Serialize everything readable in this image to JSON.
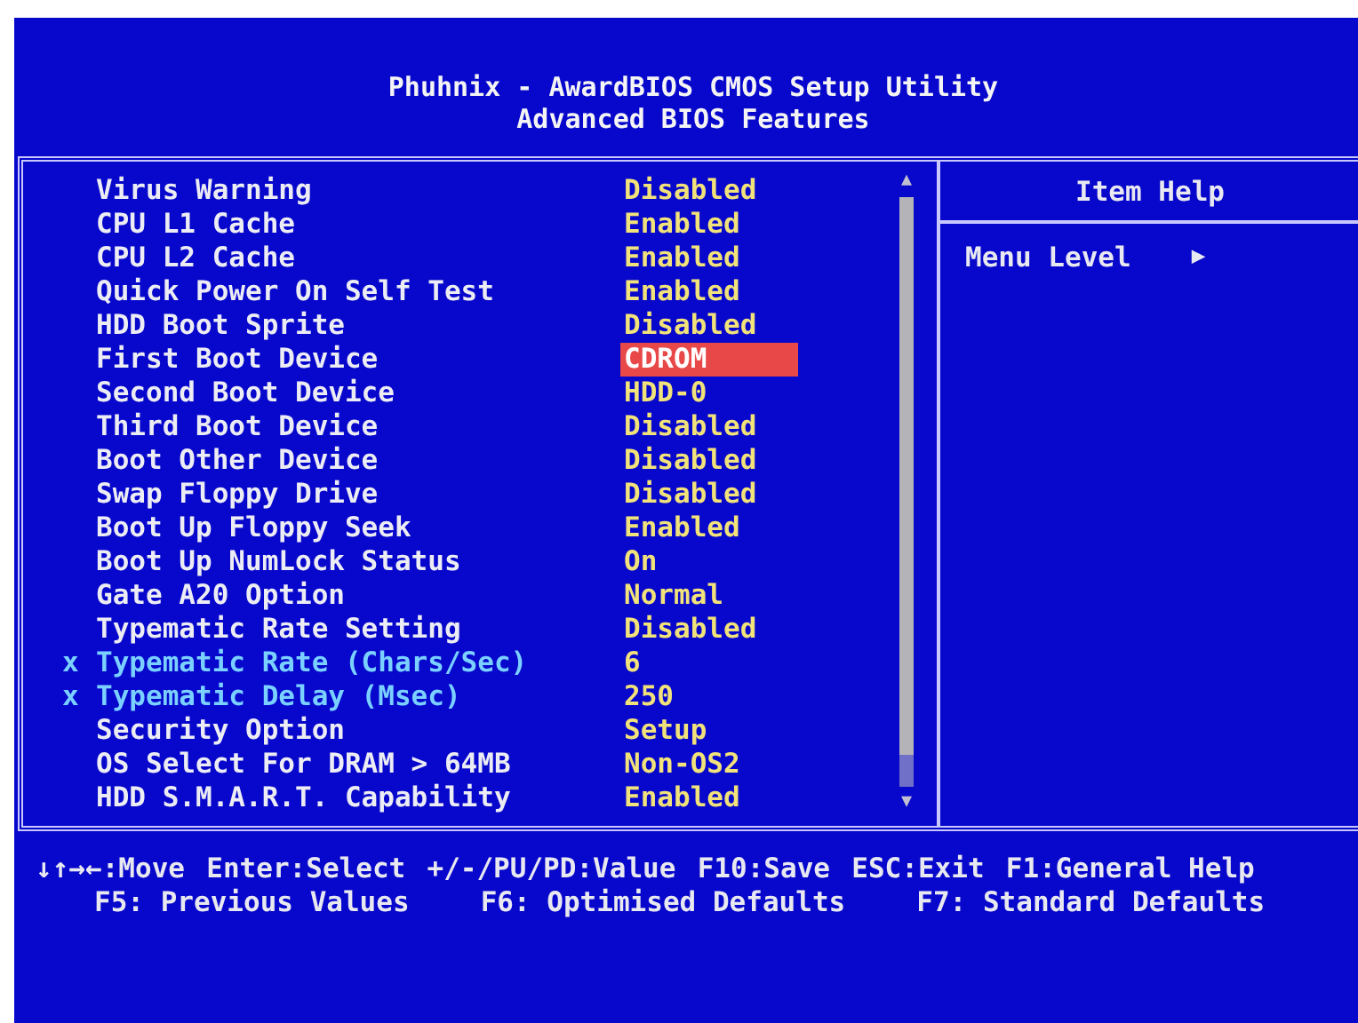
{
  "header": {
    "title": "Phuhnix - AwardBIOS CMOS Setup Utility",
    "subtitle": "Advanced BIOS Features"
  },
  "settings": [
    {
      "label": "Virus Warning",
      "value": "Disabled",
      "selected": false,
      "disabled": false
    },
    {
      "label": "CPU L1 Cache",
      "value": "Enabled",
      "selected": false,
      "disabled": false
    },
    {
      "label": "CPU L2 Cache",
      "value": "Enabled",
      "selected": false,
      "disabled": false
    },
    {
      "label": "Quick Power On Self Test",
      "value": "Enabled",
      "selected": false,
      "disabled": false
    },
    {
      "label": "HDD Boot Sprite",
      "value": "Disabled",
      "selected": false,
      "disabled": false
    },
    {
      "label": "First Boot Device",
      "value": "CDROM",
      "selected": true,
      "disabled": false
    },
    {
      "label": "Second Boot Device",
      "value": "HDD-0",
      "selected": false,
      "disabled": false
    },
    {
      "label": "Third Boot Device",
      "value": "Disabled",
      "selected": false,
      "disabled": false
    },
    {
      "label": "Boot Other Device",
      "value": "Disabled",
      "selected": false,
      "disabled": false
    },
    {
      "label": "Swap Floppy Drive",
      "value": "Disabled",
      "selected": false,
      "disabled": false
    },
    {
      "label": "Boot Up Floppy Seek",
      "value": "Enabled",
      "selected": false,
      "disabled": false
    },
    {
      "label": "Boot Up NumLock Status",
      "value": "On",
      "selected": false,
      "disabled": false
    },
    {
      "label": "Gate A20 Option",
      "value": "Normal",
      "selected": false,
      "disabled": false
    },
    {
      "label": "Typematic Rate Setting",
      "value": "Disabled",
      "selected": false,
      "disabled": false
    },
    {
      "label": "Typematic Rate (Chars/Sec)",
      "value": "6",
      "selected": false,
      "disabled": true,
      "marker": "x"
    },
    {
      "label": "Typematic Delay (Msec)",
      "value": "250",
      "selected": false,
      "disabled": true,
      "marker": "x"
    },
    {
      "label": "Security Option",
      "value": "Setup",
      "selected": false,
      "disabled": false
    },
    {
      "label": "OS Select For DRAM > 64MB",
      "value": "Non-OS2",
      "selected": false,
      "disabled": false
    },
    {
      "label": "HDD S.M.A.R.T. Capability",
      "value": "Enabled",
      "selected": false,
      "disabled": false
    }
  ],
  "scrollbar": {
    "up": "▲",
    "down": "▼"
  },
  "help": {
    "title": "Item Help",
    "menu_level": "Menu Level",
    "arrow": "▶"
  },
  "footer": {
    "line_1": [
      "↓↑→←:Move",
      "Enter:Select",
      "+/-/PU/PD:Value",
      "F10:Save",
      "ESC:Exit",
      "F1:General Help"
    ],
    "line_2": [
      "F5: Previous Values",
      "F6: Optimised Defaults",
      "F7: Standard Defaults"
    ]
  }
}
